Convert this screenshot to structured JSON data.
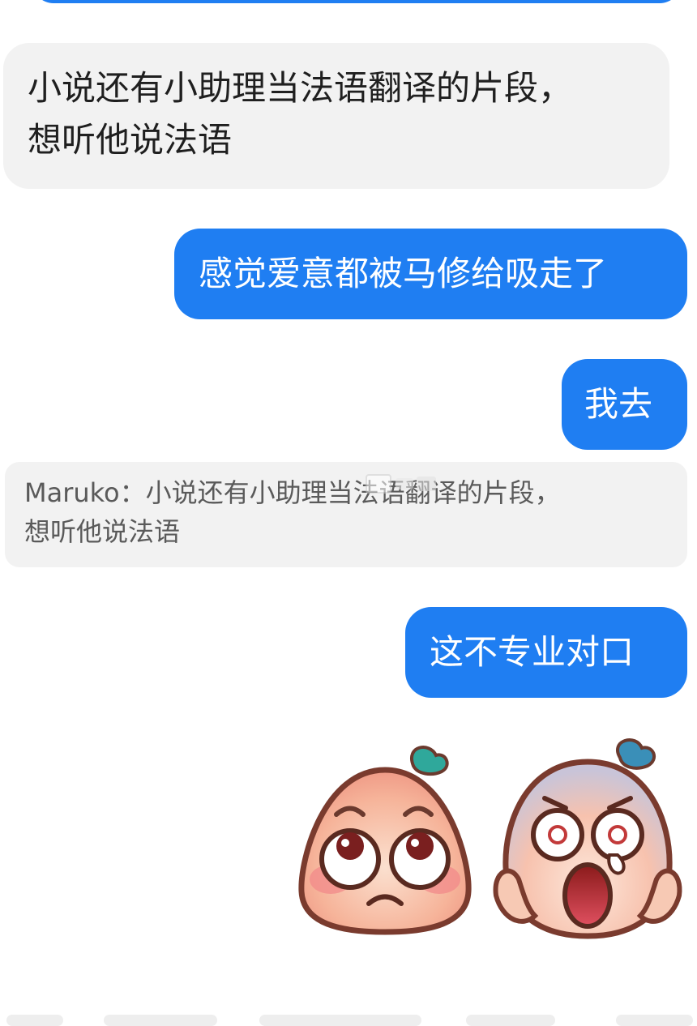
{
  "messages": [
    {
      "id": "msg-1",
      "side": "received",
      "text": "小说还有小助理当法语翻译的片段，\n想听他说法语"
    },
    {
      "id": "msg-2",
      "side": "sent",
      "text": "感觉爱意都被马修给吸走了"
    },
    {
      "id": "msg-3",
      "side": "sent",
      "text": "我去"
    },
    {
      "id": "msg-4",
      "side": "sent",
      "text": "这不专业对口"
    }
  ],
  "quote": {
    "sender": "Maruko",
    "separator": "：",
    "text": "小说还有小助理当法语翻译的片段，\n想听他说法语"
  },
  "stickers": [
    {
      "name": "rolling-eyes-sticker",
      "description_icon": "peach-face-eye-roll-icon"
    },
    {
      "name": "shocked-crying-sticker",
      "description_icon": "peach-face-scream-icon"
    }
  ],
  "colors": {
    "sent_bubble": "#1f7ef2",
    "received_bubble": "#f2f2f2",
    "received_text": "#1f1f1f",
    "quote_text": "#5a5a5a"
  }
}
